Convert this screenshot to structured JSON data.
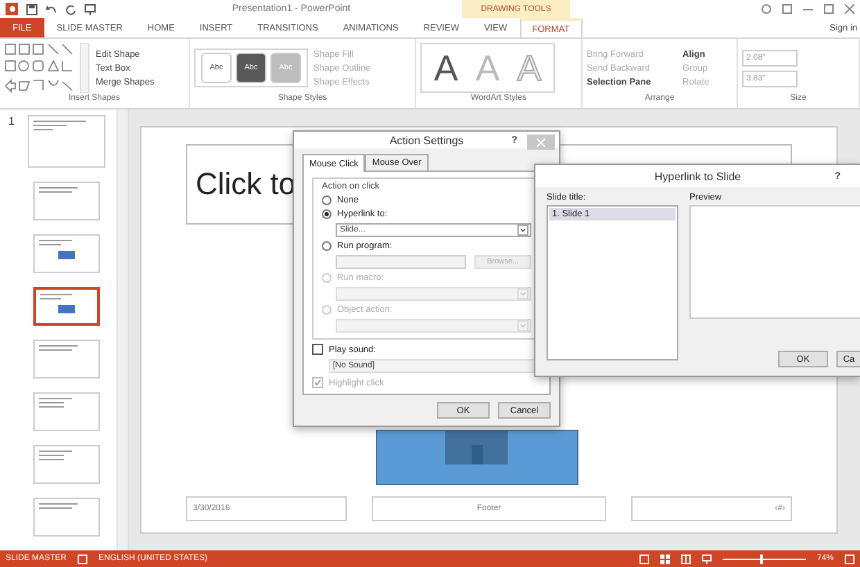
{
  "window": {
    "title": "Presentation1 - PowerPoint",
    "context_label": "DRAWING TOOLS",
    "sign_in": "Sign in"
  },
  "tabs": [
    {
      "label": "FILE",
      "kind": "file",
      "selected": false
    },
    {
      "label": "SLIDE MASTER",
      "kind": "tab",
      "selected": false
    },
    {
      "label": "HOME",
      "kind": "tab",
      "selected": false
    },
    {
      "label": "INSERT",
      "kind": "tab",
      "selected": false
    },
    {
      "label": "TRANSITIONS",
      "kind": "tab",
      "selected": false
    },
    {
      "label": "ANIMATIONS",
      "kind": "tab",
      "selected": false
    },
    {
      "label": "REVIEW",
      "kind": "tab",
      "selected": false
    },
    {
      "label": "VIEW",
      "kind": "tab",
      "selected": false
    },
    {
      "label": "FORMAT",
      "kind": "tab",
      "selected": true
    }
  ],
  "ribbon": {
    "insert_shapes": {
      "label": "Insert Shapes",
      "commands": [
        "Edit Shape",
        "Text Box",
        "Merge Shapes"
      ]
    },
    "shape_styles": {
      "label": "Shape Styles",
      "swatches": [
        {
          "text": "Abc",
          "kind": "light"
        },
        {
          "text": "Abc",
          "kind": "dark"
        },
        {
          "text": "Abc",
          "kind": "grey"
        }
      ],
      "commands": [
        "Shape Fill",
        "Shape Outline",
        "Shape Effects"
      ]
    },
    "wordart_styles": {
      "label": "WordArt Styles",
      "letters": [
        {
          "text": "A",
          "kind": "solid"
        },
        {
          "text": "A",
          "kind": "pale"
        },
        {
          "text": "A",
          "kind": "outline"
        }
      ]
    },
    "arrange": {
      "label": "Arrange",
      "commands": [
        {
          "text": "Bring Forward",
          "disabled": true
        },
        {
          "text": "Align",
          "disabled": false
        },
        {
          "text": "Send Backward",
          "disabled": true
        },
        {
          "text": "Group",
          "disabled": true
        },
        {
          "text": "Selection Pane",
          "disabled": false
        },
        {
          "text": "Rotate",
          "disabled": true
        }
      ]
    },
    "size": {
      "label": "Size",
      "height": "2.08\"",
      "width": "3.83\""
    }
  },
  "thumbnails": {
    "number": "1",
    "items": [
      {
        "selected": false,
        "kind": "master"
      },
      {
        "selected": false,
        "kind": "title"
      },
      {
        "selected": false,
        "kind": "content"
      },
      {
        "selected": true,
        "kind": "content"
      },
      {
        "selected": false,
        "kind": "title"
      },
      {
        "selected": false,
        "kind": "two"
      },
      {
        "selected": false,
        "kind": "two"
      },
      {
        "selected": false,
        "kind": "title"
      }
    ]
  },
  "slide": {
    "title_placeholder": "Click to",
    "date": "3/30/2016",
    "footer": "Footer",
    "page_number": "‹#›"
  },
  "action_settings": {
    "title": "Action Settings",
    "help": "?",
    "tabs": [
      {
        "label": "Mouse Click",
        "selected": true
      },
      {
        "label": "Mouse Over",
        "selected": false
      }
    ],
    "group_label": "Action on click",
    "options": [
      {
        "label": "None",
        "selected": false,
        "disabled": false
      },
      {
        "label": "Hyperlink to:",
        "selected": true,
        "disabled": false,
        "value": "Slide..."
      },
      {
        "label": "Run program:",
        "selected": false,
        "disabled": false,
        "button": "Browse..."
      },
      {
        "label": "Run macro:",
        "selected": false,
        "disabled": true
      },
      {
        "label": "Object action:",
        "selected": false,
        "disabled": true
      }
    ],
    "play_sound": {
      "label": "Play sound:",
      "checked": false,
      "value": "[No Sound]"
    },
    "highlight_click": {
      "label": "Highlight click",
      "checked": true,
      "disabled": true
    },
    "buttons": [
      "OK",
      "Cancel"
    ]
  },
  "hyperlink_dialog": {
    "title": "Hyperlink to Slide",
    "help": "?",
    "list_label": "Slide title:",
    "slides": [
      {
        "label": "1. Slide 1",
        "selected": true
      }
    ],
    "preview_label": "Preview",
    "buttons": [
      "OK",
      "Ca"
    ]
  },
  "status_bar": {
    "mode": "SLIDE MASTER",
    "language": "ENGLISH (UNITED STATES)",
    "zoom": "74%",
    "zoom_slider": {
      "level": 0.45
    }
  }
}
